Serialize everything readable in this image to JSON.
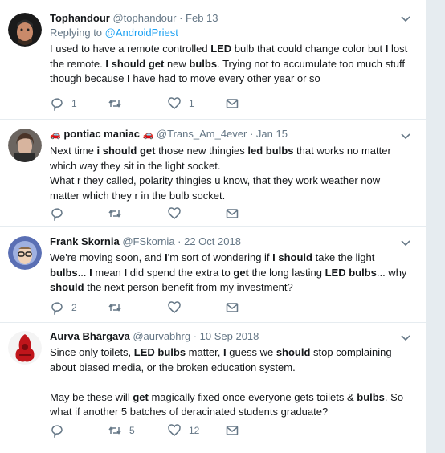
{
  "tweets": [
    {
      "name": "Tophandour",
      "handle": "@tophandour",
      "sep": " · ",
      "time": "Feb 13",
      "reply_prefix": "Replying to ",
      "reply_to": "@AndroidPriest",
      "segments": [
        {
          "t": "I used to have a remote controlled ",
          "b": false
        },
        {
          "t": "LED",
          "b": true
        },
        {
          "t": " bulb that could change color but ",
          "b": false
        },
        {
          "t": "I",
          "b": true
        },
        {
          "t": " lost the remote. ",
          "b": false
        },
        {
          "t": "I should get",
          "b": true
        },
        {
          "t": " new ",
          "b": false
        },
        {
          "t": "bulbs",
          "b": true
        },
        {
          "t": ". Trying not to accumulate too much stuff though because ",
          "b": false
        },
        {
          "t": "I",
          "b": true
        },
        {
          "t": " have had to move every other year or so",
          "b": false
        }
      ],
      "replies": "1",
      "retweets": "",
      "likes": "1"
    },
    {
      "name": "pontiac maniac",
      "emoji": "🚗",
      "handle": "@Trans_Am_4ever",
      "sep": " · ",
      "time": "Jan 15",
      "segments": [
        {
          "t": "Next time ",
          "b": false
        },
        {
          "t": "i should get",
          "b": true
        },
        {
          "t": " those new thingies ",
          "b": false
        },
        {
          "t": "led bulbs",
          "b": true
        },
        {
          "t": " that works no matter which way they sit in the light socket.",
          "b": false
        },
        {
          "t": "\n",
          "b": false
        },
        {
          "t": "What r they called, polarity thingies u know, that they work weather now matter which they r in the bulb socket.",
          "b": false
        }
      ],
      "replies": "",
      "retweets": "",
      "likes": ""
    },
    {
      "name": "Frank Skornia",
      "handle": "@FSkornia",
      "sep": " · ",
      "time": "22 Oct 2018",
      "segments": [
        {
          "t": "We're moving soon, and ",
          "b": false
        },
        {
          "t": "I",
          "b": true
        },
        {
          "t": "'m sort of wondering if ",
          "b": false
        },
        {
          "t": "I should",
          "b": true
        },
        {
          "t": " take the light ",
          "b": false
        },
        {
          "t": "bulbs",
          "b": true
        },
        {
          "t": "... ",
          "b": false
        },
        {
          "t": "I",
          "b": true
        },
        {
          "t": " mean ",
          "b": false
        },
        {
          "t": "I",
          "b": true
        },
        {
          "t": " did spend the extra to ",
          "b": false
        },
        {
          "t": "get",
          "b": true
        },
        {
          "t": " the long lasting ",
          "b": false
        },
        {
          "t": "LED bulbs",
          "b": true
        },
        {
          "t": "... why ",
          "b": false
        },
        {
          "t": "should",
          "b": true
        },
        {
          "t": " the next person benefit from my investment?",
          "b": false
        }
      ],
      "replies": "2",
      "retweets": "",
      "likes": ""
    },
    {
      "name": "Aurva Bhārgava",
      "handle": "@aurvabhrg",
      "sep": " · ",
      "time": "10 Sep 2018",
      "segments": [
        {
          "t": "Since only toilets, ",
          "b": false
        },
        {
          "t": "LED bulbs",
          "b": true
        },
        {
          "t": " matter, ",
          "b": false
        },
        {
          "t": "I",
          "b": true
        },
        {
          "t": " guess we ",
          "b": false
        },
        {
          "t": "should",
          "b": true
        },
        {
          "t": " stop complaining about biased media, or the broken education system.",
          "b": false
        },
        {
          "t": "\n\n",
          "b": false
        },
        {
          "t": "May be these will ",
          "b": false
        },
        {
          "t": "get",
          "b": true
        },
        {
          "t": " magically fixed once everyone gets toilets & ",
          "b": false
        },
        {
          "t": "bulbs",
          "b": true
        },
        {
          "t": ". So what if another 5 batches of deracinated students graduate?",
          "b": false
        }
      ],
      "replies": "",
      "retweets": "5",
      "likes": "12"
    }
  ],
  "colors": {
    "link": "#1da1f2",
    "muted": "#657786",
    "text": "#14171a",
    "divider": "#e6ecf0"
  },
  "icons": [
    "reply-icon",
    "retweet-icon",
    "like-icon",
    "message-icon",
    "chevron-down-icon"
  ]
}
